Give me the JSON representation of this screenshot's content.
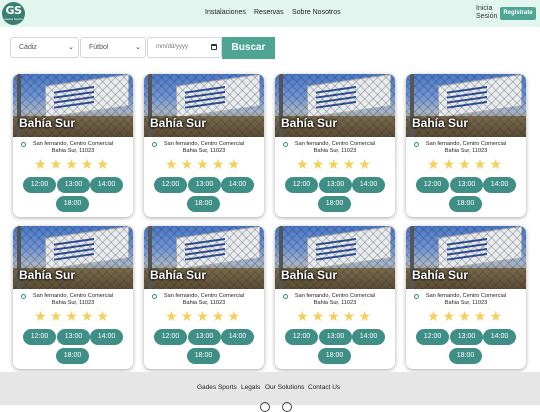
{
  "logo": {
    "mark": "GS",
    "sub": "Gades Sports"
  },
  "nav": {
    "items": [
      "Instalaciones",
      "Reservas",
      "Sobre Nosotros"
    ]
  },
  "auth": {
    "login_line1": "Inicia",
    "login_line2": "Sesión",
    "register": "Regístrate"
  },
  "filters": {
    "city": "Cádiz",
    "sport": "Fútbol",
    "date_placeholder": "mm/dd/yyyy",
    "search_label": "Buscar"
  },
  "cards": [
    {
      "name": "Bahía Sur",
      "address1": "San fernando, Centro Comercial",
      "address2": "Bahia Sur, 11023",
      "stars": "★★★★★",
      "slots": [
        "12:00",
        "13:00",
        "14:00",
        "18:00"
      ]
    },
    {
      "name": "Bahía Sur",
      "address1": "San fernando, Centro Comercial",
      "address2": "Bahia Sur, 11023",
      "stars": "★★★★★",
      "slots": [
        "12:00",
        "13:00",
        "14:00",
        "18:00"
      ]
    },
    {
      "name": "Bahía Sur",
      "address1": "San fernando, Centro Comercial",
      "address2": "Bahia Sur, 11023",
      "stars": "★★★★★",
      "slots": [
        "12:00",
        "13:00",
        "14:00",
        "18:00"
      ]
    },
    {
      "name": "Bahía Sur",
      "address1": "San fernando, Centro Comercial",
      "address2": "Bahia Sur, 11023",
      "stars": "★★★★★",
      "slots": [
        "12:00",
        "13:00",
        "14:00",
        "18:00"
      ]
    },
    {
      "name": "Bahía Sur",
      "address1": "San fernando, Centro Comercial",
      "address2": "Bahia Sur, 11023",
      "stars": "★★★★★",
      "slots": [
        "12:00",
        "13:00",
        "14:00",
        "18:00"
      ]
    },
    {
      "name": "Bahía Sur",
      "address1": "San fernando, Centro Comercial",
      "address2": "Bahia Sur, 11023",
      "stars": "★★★★★",
      "slots": [
        "12:00",
        "13:00",
        "14:00",
        "18:00"
      ]
    },
    {
      "name": "Bahía Sur",
      "address1": "San fernando, Centro Comercial",
      "address2": "Bahia Sur, 11023",
      "stars": "★★★★★",
      "slots": [
        "12:00",
        "13:00",
        "14:00",
        "18:00"
      ]
    },
    {
      "name": "Bahía Sur",
      "address1": "San fernando, Centro Comercial",
      "address2": "Bahia Sur, 11023",
      "stars": "★★★★★",
      "slots": [
        "12:00",
        "13:00",
        "14:00",
        "18:00"
      ]
    }
  ],
  "rating_stars": 5,
  "footer": {
    "links": [
      "Gades Sports",
      "Legals",
      "Our Solutions",
      "Contact Us"
    ]
  },
  "colors": {
    "accent": "#4ea593",
    "slot": "#3f8f86",
    "header_bg": "#e3f5ef",
    "star": "#f5cf58",
    "footer_bg": "#e6e6e6"
  }
}
